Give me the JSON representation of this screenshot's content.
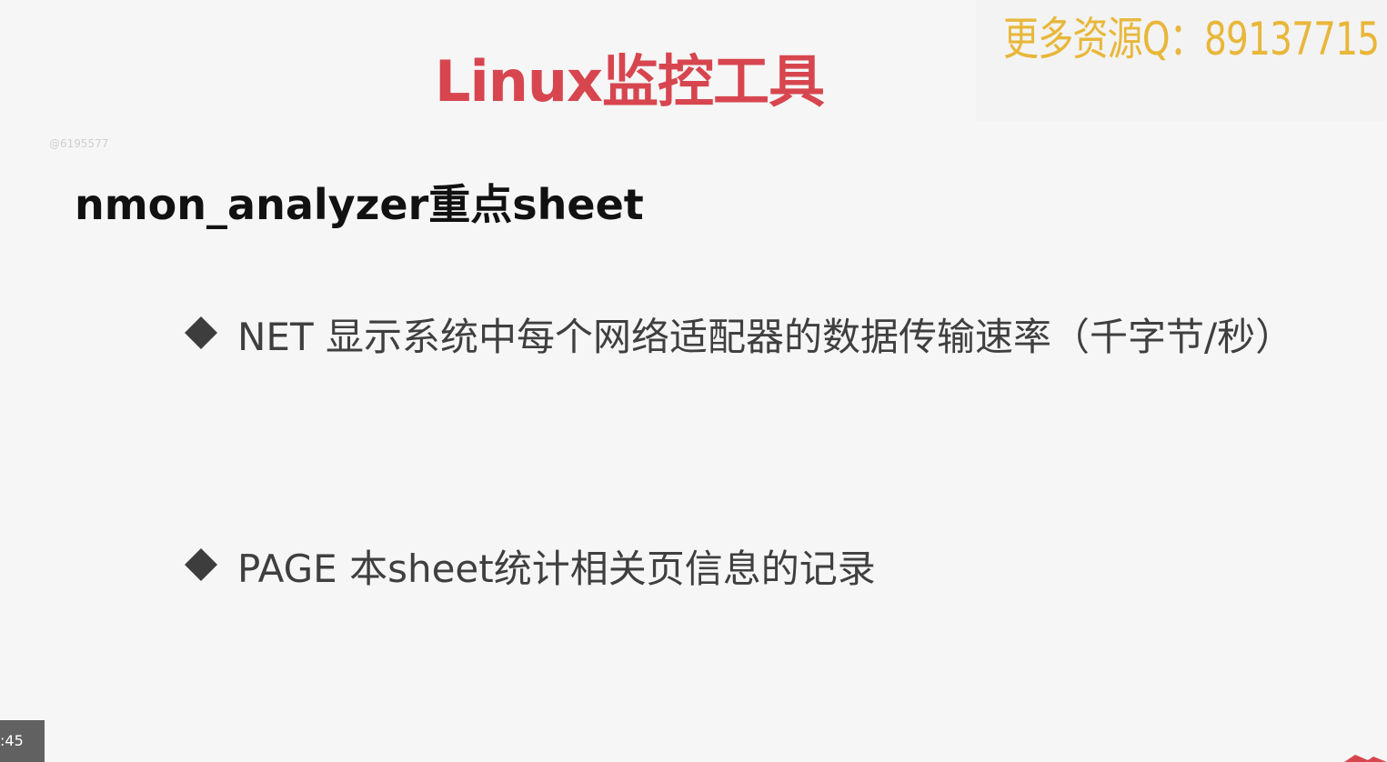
{
  "watermark": {
    "text": "更多资源Q：89137715"
  },
  "slide": {
    "title": "Linux监控工具",
    "small_mark": "@6195577",
    "section_heading": "nmon_analyzer重点sheet",
    "bullets": [
      {
        "text": "NET 显示系统中每个网络适配器的数据传输速率（千字节/秒）"
      },
      {
        "text": "PAGE 本sheet统计相关页信息的记录"
      }
    ]
  },
  "player": {
    "time_fragment": ":45"
  },
  "colors": {
    "title": "#d7464f",
    "watermark": "#e8b73a",
    "bullet_text": "#3f3f3f",
    "heading": "#111111",
    "background": "#f6f6f6"
  },
  "icons": {
    "bullet": "diamond-bullet-icon",
    "corner": "corner-mark-icon"
  }
}
